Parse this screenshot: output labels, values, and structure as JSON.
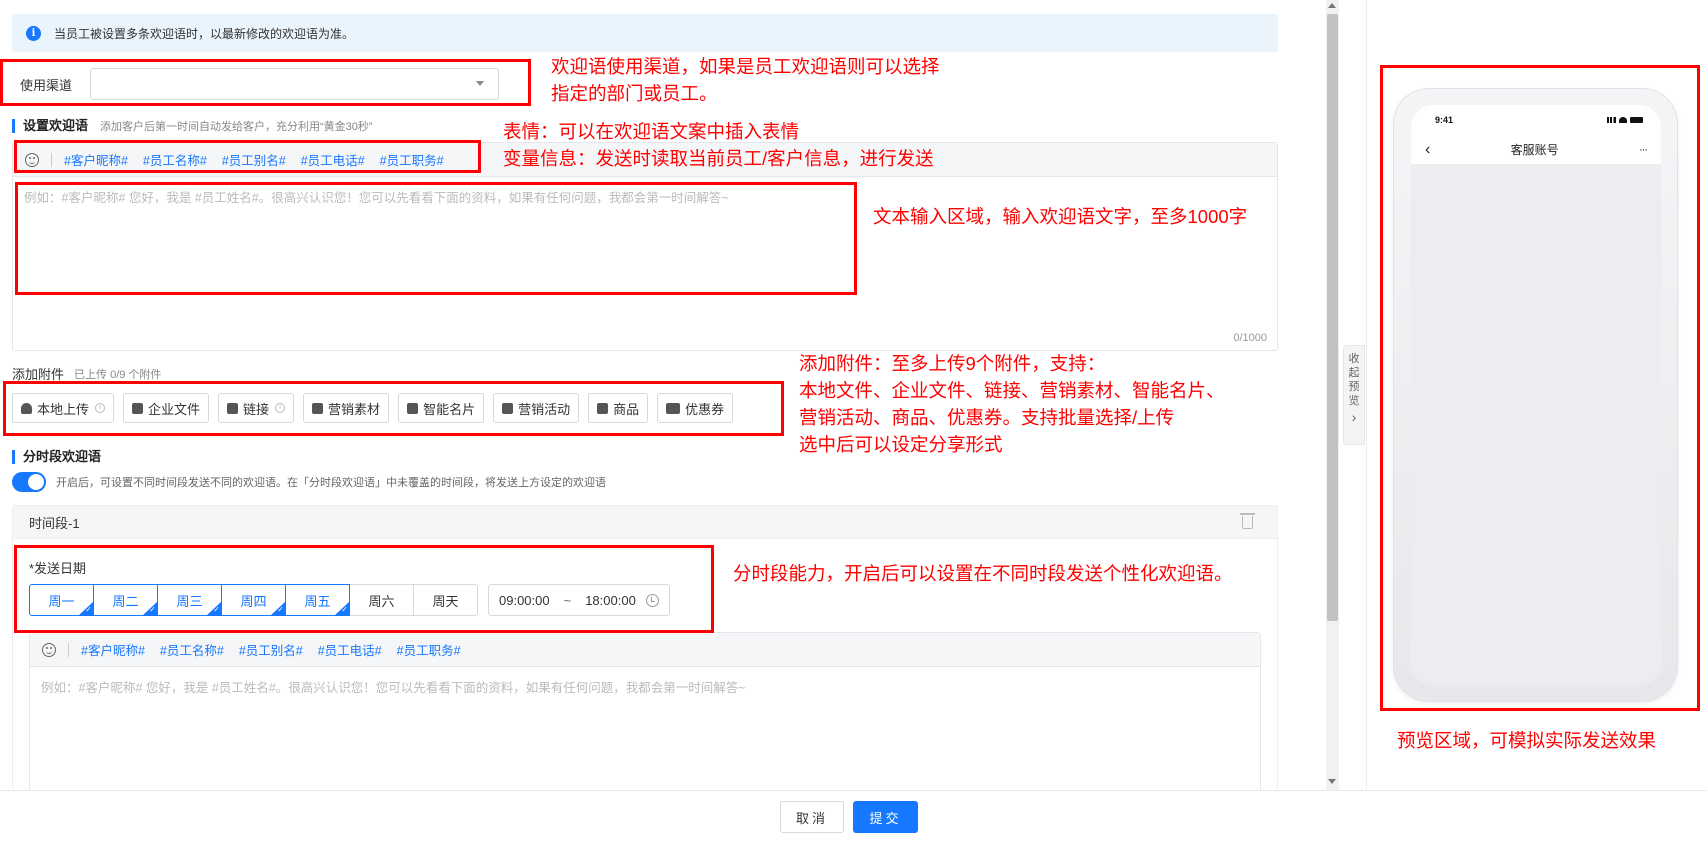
{
  "notice": {
    "text": "当员工被设置多条欢迎语时，以最新修改的欢迎语为准。"
  },
  "channel": {
    "label": "使用渠道",
    "value": ""
  },
  "welcome": {
    "title": "设置欢迎语",
    "hint": "添加客户后第一时间自动发给客户，充分利用“黄金30秒”",
    "variables": [
      "#客户昵称#",
      "#员工名称#",
      "#员工别名#",
      "#员工电话#",
      "#员工职务#"
    ],
    "placeholder": "例如：#客户昵称# 您好，我是 #员工姓名#。很高兴认识您！您可以先看看下面的资料，如果有任何问题，我都会第一时间解答~",
    "counter": "0/1000"
  },
  "attachments": {
    "title": "添加附件",
    "hint": "已上传 0/9 个附件",
    "buttons": [
      "本地上传",
      "企业文件",
      "链接",
      "营销素材",
      "智能名片",
      "营销活动",
      "商品",
      "优惠券"
    ]
  },
  "timed": {
    "title": "分时段欢迎语",
    "enabled": true,
    "desc": "开启后，可设置不同时间段发送不同的欢迎语。在「分时段欢迎语」中未覆盖的时间段，将发送上方设定的欢迎语",
    "period_title": "时间段-1",
    "date_label": "*发送日期",
    "days": [
      "周一",
      "周二",
      "周三",
      "周四",
      "周五",
      "周六",
      "周天"
    ],
    "selected_days": [
      true,
      true,
      true,
      true,
      true,
      false,
      false
    ],
    "start_time": "09:00:00",
    "separator": "~",
    "end_time": "18:00:00",
    "variables": [
      "#客户昵称#",
      "#员工名称#",
      "#员工别名#",
      "#员工电话#",
      "#员工职务#"
    ],
    "placeholder": "例如：#客户昵称# 您好，我是 #员工姓名#。很高兴认识您！您可以先看看下面的资料，如果有任何问题，我都会第一时间解答~"
  },
  "preview": {
    "collapse_label": [
      "收",
      "起",
      "预",
      "览",
      "›"
    ],
    "time": "9:41",
    "back": "‹",
    "title": "客服账号",
    "more": "···"
  },
  "footer": {
    "cancel": "取消",
    "submit": "提交"
  },
  "annotations": {
    "channel": [
      "欢迎语使用渠道，如果是员工欢迎语则可以选择",
      "指定的部门或员工。"
    ],
    "toolbar": [
      "表情：可以在欢迎语文案中插入表情",
      "变量信息：发送时读取当前员工/客户信息，进行发送"
    ],
    "input": "文本输入区域，输入欢迎语文字，至多1000字",
    "attach": [
      "添加附件：至多上传9个附件，支持：",
      "本地文件、企业文件、链接、营销素材、智能名片、",
      "营销活动、商品、优惠券。支持批量选择/上传",
      "选中后可以设定分享形式"
    ],
    "timed": "分时段能力，开启后可以设置在不同时段发送个性化欢迎语。",
    "preview": "预览区域，可模拟实际发送效果"
  },
  "colors": {
    "primary": "#1677ff",
    "annotation": "#ff0000"
  }
}
